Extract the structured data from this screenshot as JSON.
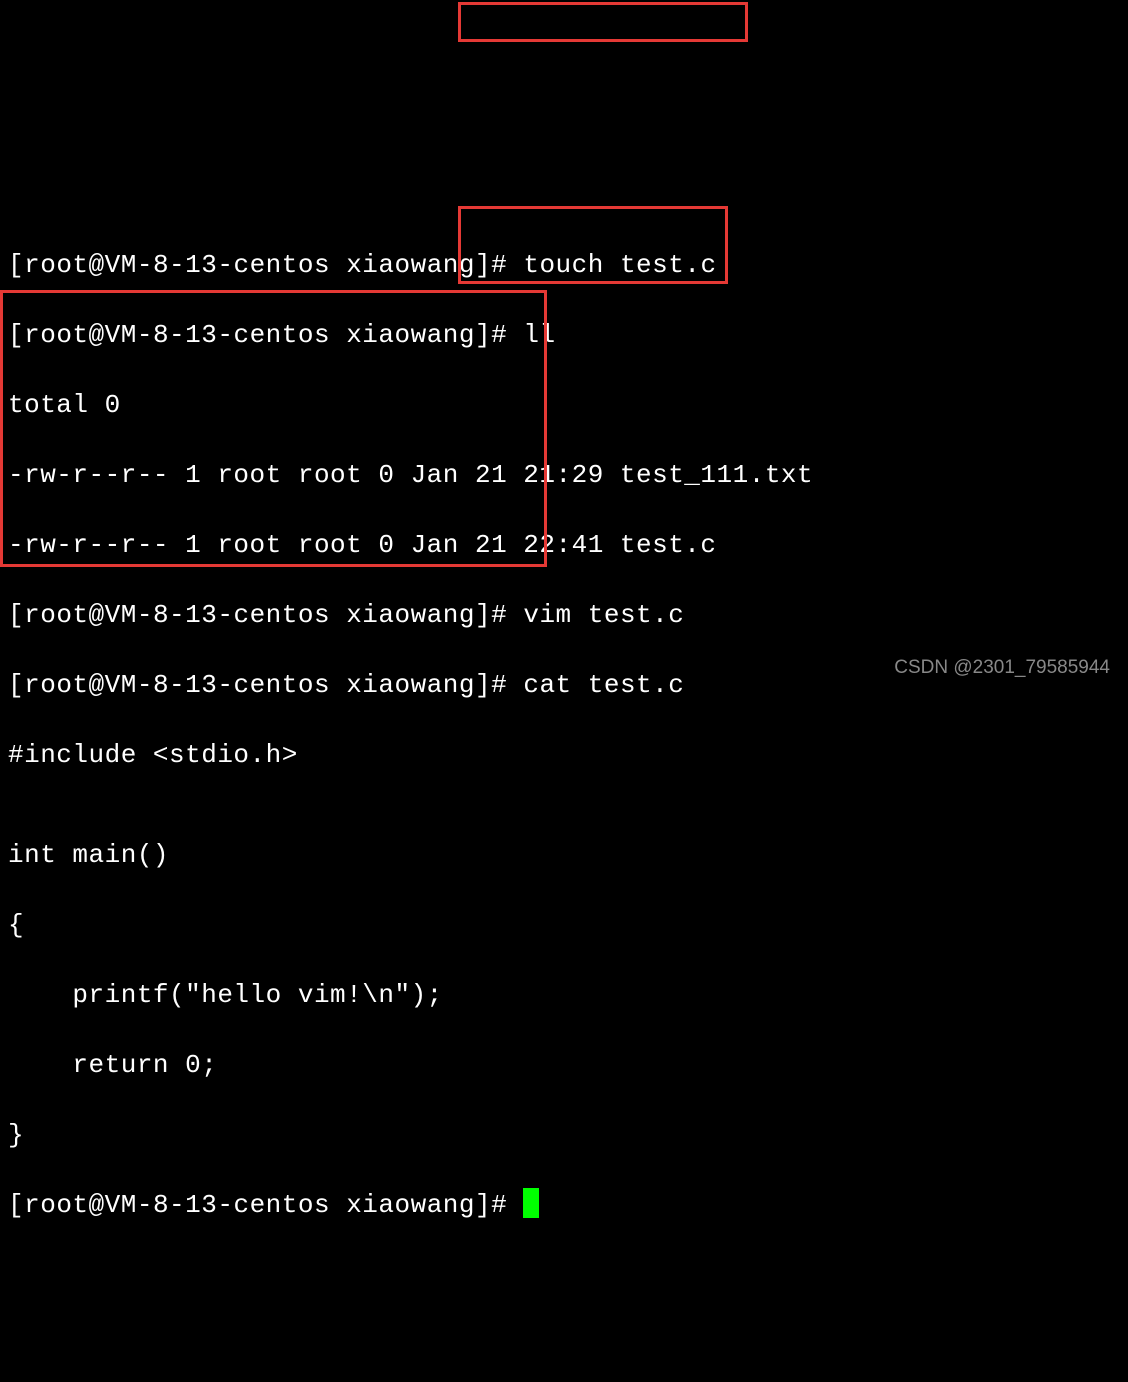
{
  "prompt": {
    "open": "[",
    "user": "root",
    "at": "@",
    "host": "VM-8-13-centos",
    "path": "xiaowang",
    "close": "]#"
  },
  "lines": {
    "l0_cmd": "touch test.c",
    "l1_cmd": "ll",
    "l2": "total 0",
    "l3": "-rw-r--r-- 1 root root 0 Jan 21 21:29 test_111.txt",
    "l4": "-rw-r--r-- 1 root root 0 Jan 21 22:41 test.c",
    "l5_cmd": "vim test.c",
    "l6_cmd": "cat test.c",
    "l7": "#include <stdio.h>",
    "l8": "",
    "l9": "int main()",
    "l10": "{",
    "l11": "    printf(\"hello vim!\\n\");",
    "l12": "    return 0;",
    "l13": "}"
  },
  "watermark": "CSDN @2301_79585944"
}
